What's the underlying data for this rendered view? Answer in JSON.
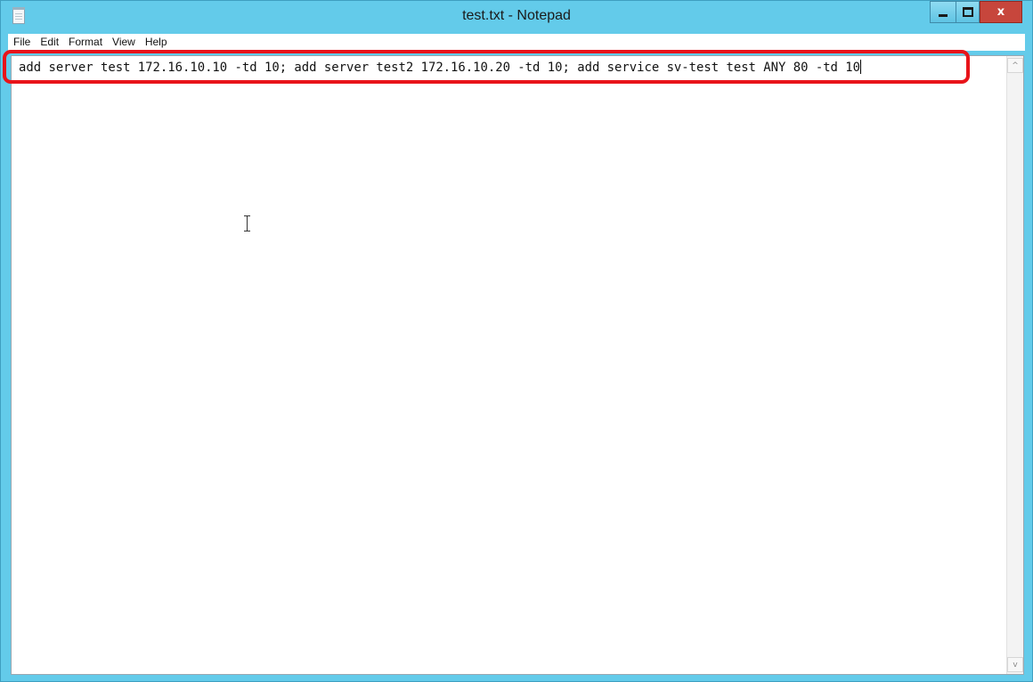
{
  "window": {
    "title": "test.txt - Notepad",
    "title_bar_color": "#63cbea",
    "close_button_color": "#c7463c",
    "close_label": "x"
  },
  "menu": {
    "items": [
      {
        "label": "File"
      },
      {
        "label": "Edit"
      },
      {
        "label": "Format"
      },
      {
        "label": "View"
      },
      {
        "label": "Help"
      }
    ]
  },
  "editor": {
    "content": "add server test 172.16.10.10 -td 10; add server test2 172.16.10.20 -td 10; add service sv-test test ANY 80 -td 10"
  },
  "scrollbar": {
    "up_arrow": "^",
    "down_arrow": "v"
  },
  "annotation": {
    "highlight_color": "#e8141a"
  }
}
